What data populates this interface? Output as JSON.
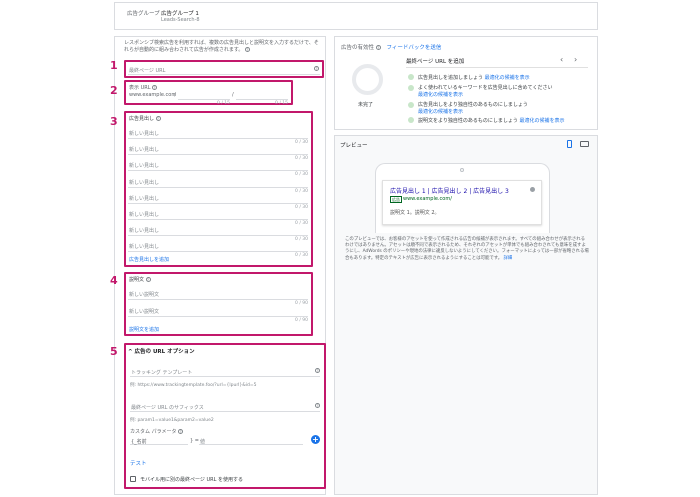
{
  "header": {
    "label": "広告グループ",
    "name": "広告グループ 1",
    "sub": "Leads-Search-8"
  },
  "intro": "レスポンシブ検索広告を利用すれば、複数の広告見出しと説明文を入力するだけで、それらが自動的に組み合わされて広告が作成されます。",
  "callouts": [
    "1",
    "2",
    "3",
    "4",
    "5"
  ],
  "final_url": {
    "placeholder": "最終ページ URL"
  },
  "display_url": {
    "label": "表示 URL",
    "domain": "www.example.com",
    "slash1": "/",
    "slash2": "/",
    "count1": "0 / 15",
    "count2": "0 / 15"
  },
  "headlines": {
    "label": "広告見出し",
    "placeholder": "新しい見出し",
    "count": "0 / 30",
    "rows": 8,
    "add": "広告見出しを追加"
  },
  "descriptions": {
    "label": "説明文",
    "placeholder": "新しい説明文",
    "count": "0 / 90",
    "rows": 2,
    "add": "説明文を追加"
  },
  "url_options": {
    "title": "広告の URL オプション",
    "tracking_label": "トラッキング テンプレート",
    "tracking_example": "例: https://www.trackingtemplate.foo/?url={lpurl}&id=5",
    "suffix_label": "最終ページ URL のサフィックス",
    "suffix_example": "例: param1=value1&param2=value2",
    "custom_label": "カスタム パラメータ",
    "name_label": "{_名前",
    "equals": "} =",
    "value_label": "値",
    "test": "テスト",
    "mobile_label": "モバイル用に別の最終ページ URL を使用する"
  },
  "strength": {
    "title": "広告の有効性",
    "feedback": "フィードバックを送信",
    "status": "未完了",
    "tip_title": "最終ページ URL を追加",
    "items": [
      {
        "text": "広告見出しを追加しましょう",
        "link": "最適化の候補を表示"
      },
      {
        "text": "よく使われているキーワードを広告見出しに含めてください",
        "link": "最適化の候補を表示"
      },
      {
        "text": "広告見出しをより独自性のあるものにしましょう",
        "link": "最適化の候補を表示"
      },
      {
        "text": "説明文をより独自性のあるものにしましょう",
        "link": "最適化の候補を表示"
      }
    ]
  },
  "preview": {
    "title": "プレビュー",
    "headline": "広告見出し 1 | 広告見出し 2 | 広告見出し 3",
    "ad_badge": "広告",
    "url": "www.example.com/",
    "desc": "説明文 1。説明文 2。",
    "note": "このプレビューでは、お客様のアセットを使って作成される広告の候補が表示されます。すべての組み合わせが表示されるわけではありません。アセットは順不同で表示されるため、それぞれのアセットが単体でも組み合わされても意味を成すようにし、AdWords のポリシーや現地の法律に違反しないようにしてください。フォーマットによっては一部が省略される場合もあります。特定のテキストが広告に表示されるようにすることは可能です。",
    "note_link": "詳細"
  },
  "colors": {
    "accent": "#1a73e8",
    "callout": "#c2186b",
    "check": "#c8e6c9"
  }
}
